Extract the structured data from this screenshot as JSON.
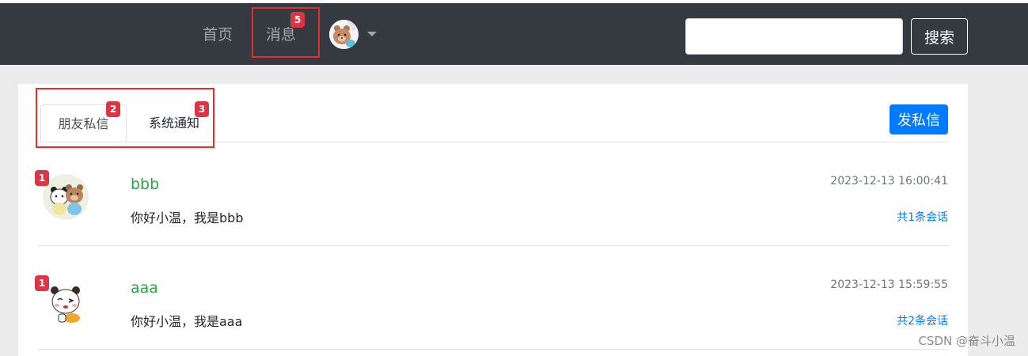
{
  "nav": {
    "home_label": "首页",
    "messages_label": "消息",
    "messages_badge": "5",
    "search_placeholder": "",
    "search_value": "",
    "search_button": "搜索"
  },
  "tabs": [
    {
      "label": "朋友私信",
      "badge": "2",
      "active": true
    },
    {
      "label": "系统通知",
      "badge": "3",
      "active": false
    }
  ],
  "send_button": "发私信",
  "conversations": [
    {
      "name": "bbb",
      "unread": "1",
      "time": "2023-12-13 16:00:41",
      "message": "你好小温，我是bbb",
      "count_link": "共1条会话",
      "avatar": "two-bears-avatar"
    },
    {
      "name": "aaa",
      "unread": "1",
      "time": "2023-12-13 15:59:55",
      "message": "你好小温，我是aaa",
      "count_link": "共2条会话",
      "avatar": "panda-bear-avatar"
    }
  ],
  "watermark": "CSDN @奋斗小温",
  "colors": {
    "navbar": "#343a40",
    "badge": "#dc3545",
    "primary": "#007bff",
    "username": "#28a745",
    "highlight_box": "#e0312f"
  }
}
